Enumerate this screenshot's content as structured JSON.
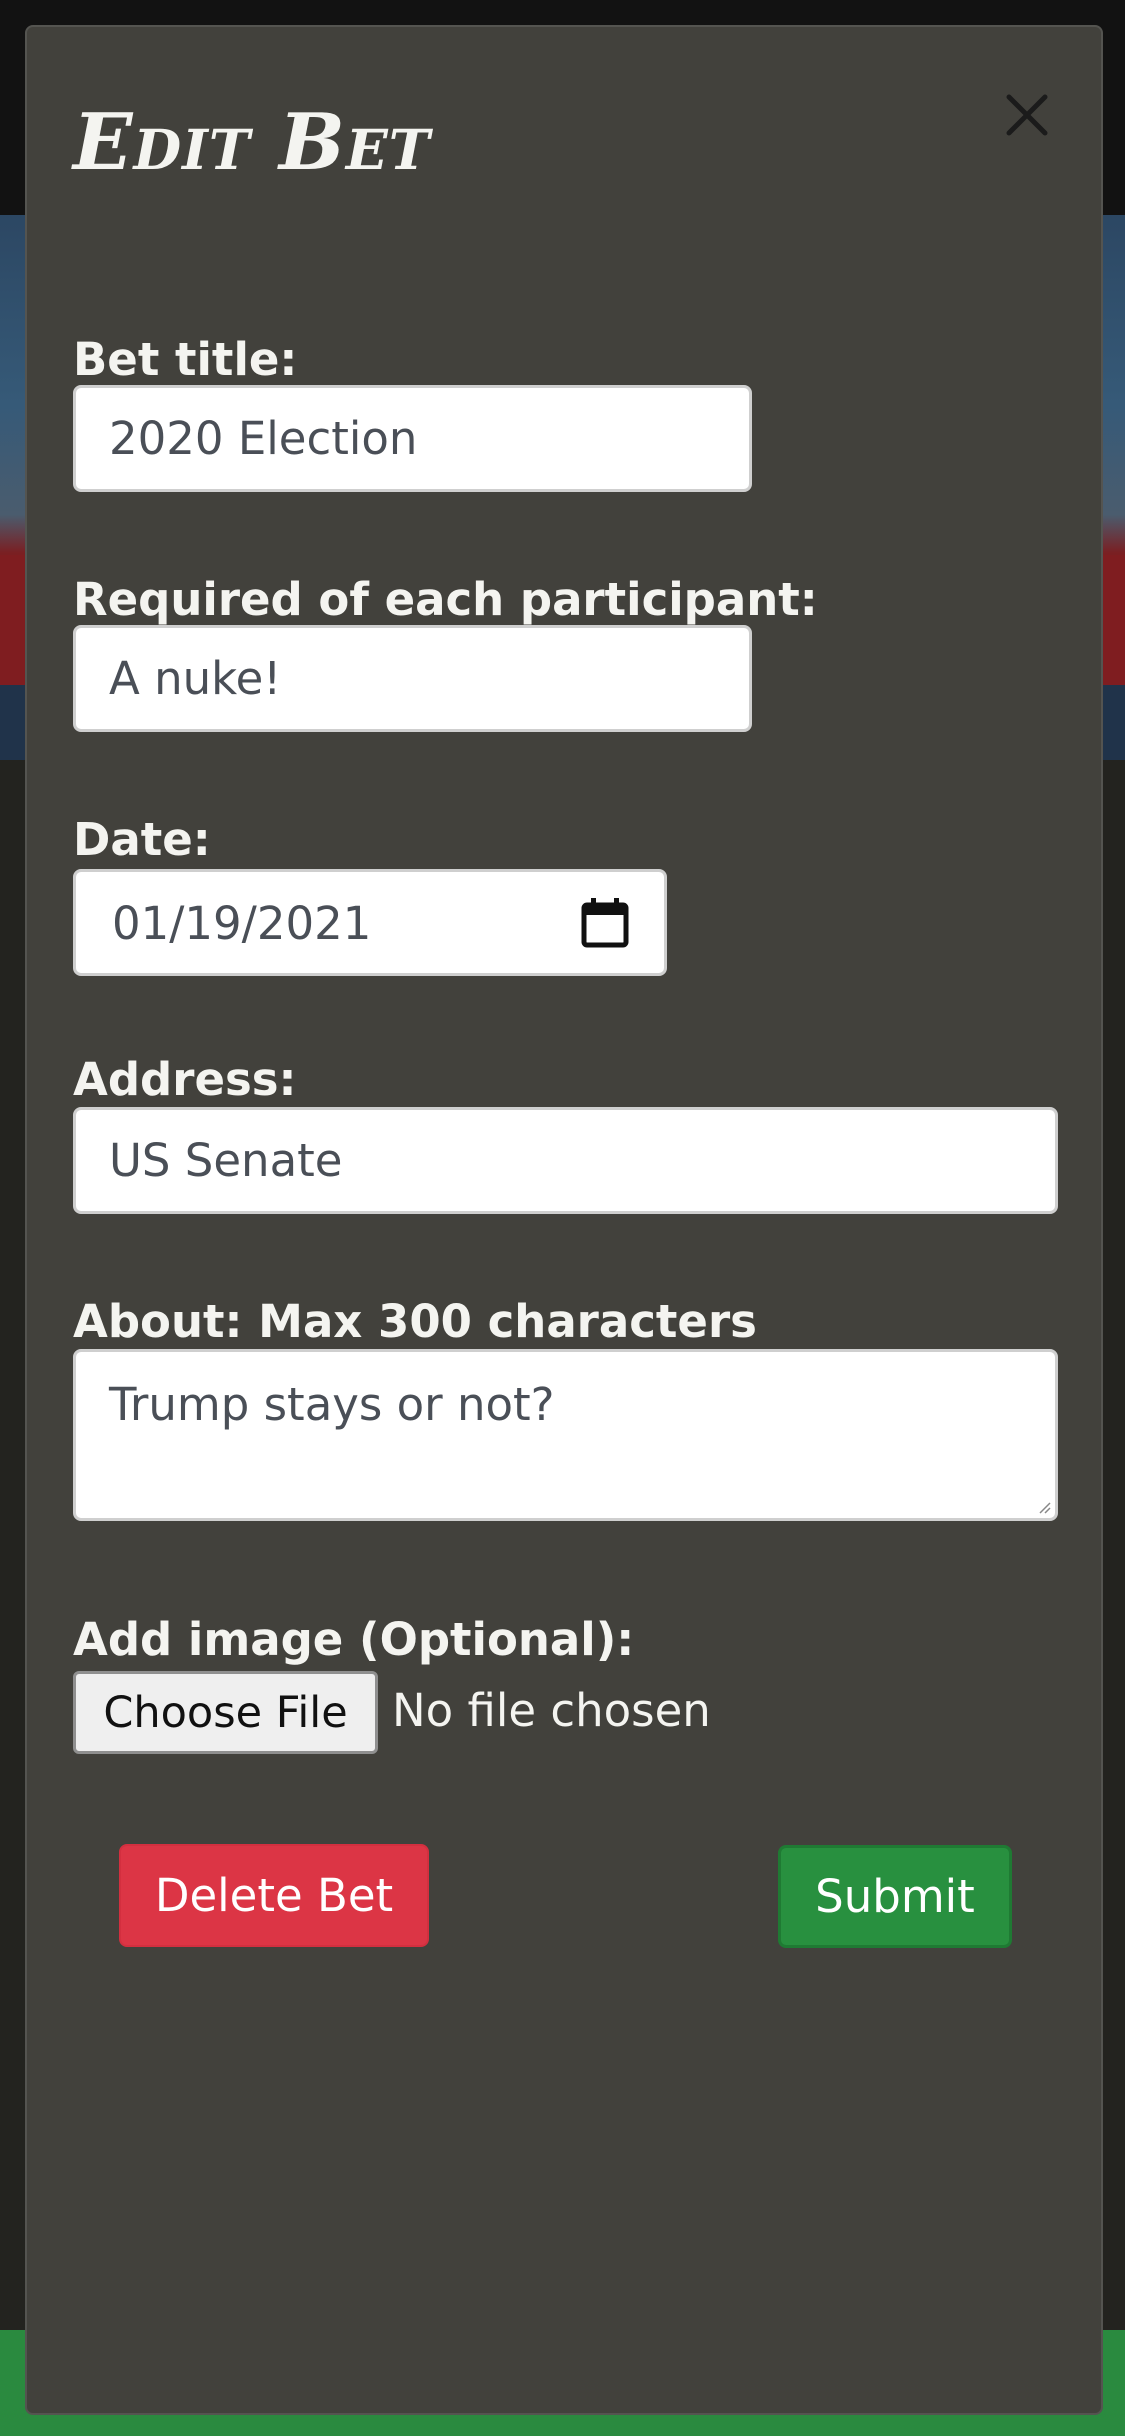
{
  "modal": {
    "title": "Edit Bet",
    "close_icon": "close-icon"
  },
  "fields": {
    "title_label": "Bet title:",
    "title_value": "2020 Election",
    "required_label": "Required of each participant:",
    "required_value": "A nuke!",
    "date_label": "Date:",
    "date_value": "01/19/2021",
    "address_label": "Address:",
    "address_value": "US Senate",
    "about_label": "About: Max 300 characters",
    "about_value": "Trump stays or not?",
    "image_label": "Add image (Optional):",
    "file_button": "Choose File",
    "file_status": "No file chosen"
  },
  "actions": {
    "delete_label": "Delete Bet",
    "submit_label": "Submit"
  },
  "colors": {
    "modal_bg": "#42413c",
    "delete": "#dc3545",
    "submit": "#28903f"
  }
}
